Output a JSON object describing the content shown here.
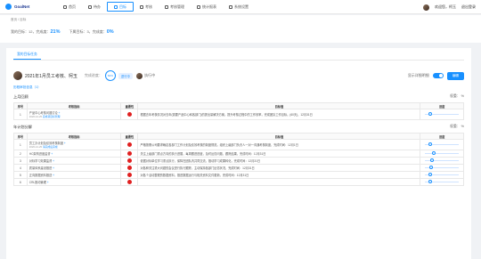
{
  "app": {
    "logo": "GoalNet"
  },
  "nav": [
    {
      "label": "首页"
    },
    {
      "label": "待办"
    },
    {
      "label": "目标"
    },
    {
      "label": "考核"
    },
    {
      "label": "考核管理"
    },
    {
      "label": "统计报表"
    },
    {
      "label": "系统设置"
    }
  ],
  "user": {
    "greeting": "欢迎您，柯玉",
    "logout": "退出登录"
  },
  "breadcrumb": {
    "path": "首页 / 目标"
  },
  "stats": {
    "my_label": "我的目标：12，完成度：",
    "my_pct": "21%",
    "sub_label": "下属目标：3，完成度：",
    "sub_pct": "0%"
  },
  "tab": "我的目标任务",
  "header": {
    "title": "2021年1月员工考核、柯玉",
    "pct_label": "完成进度：",
    "ring": "62%",
    "status": "进行中",
    "owner": "执行中",
    "show_label": "显示详细明细",
    "button": "编辑"
  },
  "history": "历程审批信息（1）",
  "sections": [
    {
      "name": "上月回顾",
      "weight": "权重：  %",
      "rows": [
        {
          "no": "1",
          "title": "产品中心考核问题讨论",
          "date": "2020-12-25",
          "link": "完成项目标管理",
          "dot": "#e02020",
          "desc": "根据去年考核情况对去年(需要产品中心和各部门)的提出量解决方案。提升考核过程中的工作效率，完成团队工作目标。(60天)，12月31日",
          "slider": 0.1
        }
      ]
    },
    {
      "name": "年计划分解",
      "weight": "权重：  %",
      "rows": [
        {
          "no": "1",
          "title": "员工办计划及绩效考核制度",
          "date": "2020-12-25",
          "link": "请完成后完成",
          "dot": "#e02020",
          "desc": "严格按照公司要求确定各部门工作计划及绩效考核的制度规范。组织上级部门负责人一对一沟通考核制度，完成时间：12月1日",
          "slider": 0.1
        },
        {
          "no": "2",
          "title": "HC架构进度监督",
          "date": "",
          "link": "",
          "dot": "#e02020",
          "desc": "关注上级部门重点方向的执行进展，每周跟进进度，及时反馈问题，跟踪结果。完成时间：12月31日",
          "slider": 0.2
        },
        {
          "no": "3",
          "title": "对标学习效果监督",
          "date": "",
          "link": "",
          "dot": "#e02020",
          "desc": "依据对标单位学习重点执行，保障在团队内共同交流，推动学习成果转化，完成时间：12月31日",
          "slider": 0.15
        },
        {
          "no": "4",
          "title": "质量体系建设推进",
          "date": "",
          "link": "",
          "dot": "#e02020",
          "desc": "对各种关注重大问题的会议进行执行跟踪，主动保持各部门反馈状况，完成时间：12月31日",
          "slider": 0.12
        },
        {
          "no": "5",
          "title": "正向数据资料推送",
          "date": "",
          "link": "",
          "dot": "#e02020",
          "desc": "对各个活动整理的数据资料，推进数据运行与相关资料文件更新，完成时间：12月31日",
          "slider": 0.1
        },
        {
          "no": "6",
          "title": "CRL推动管理",
          "date": "",
          "link": "",
          "dot": "#e02020",
          "desc": "",
          "slider": 0.1
        }
      ]
    }
  ],
  "table_headers": [
    "序号",
    "考核指标",
    "重要性",
    "目标值",
    "进度"
  ],
  "icons": {
    "add": "plus-icon",
    "avatar": "avatar-icon"
  }
}
